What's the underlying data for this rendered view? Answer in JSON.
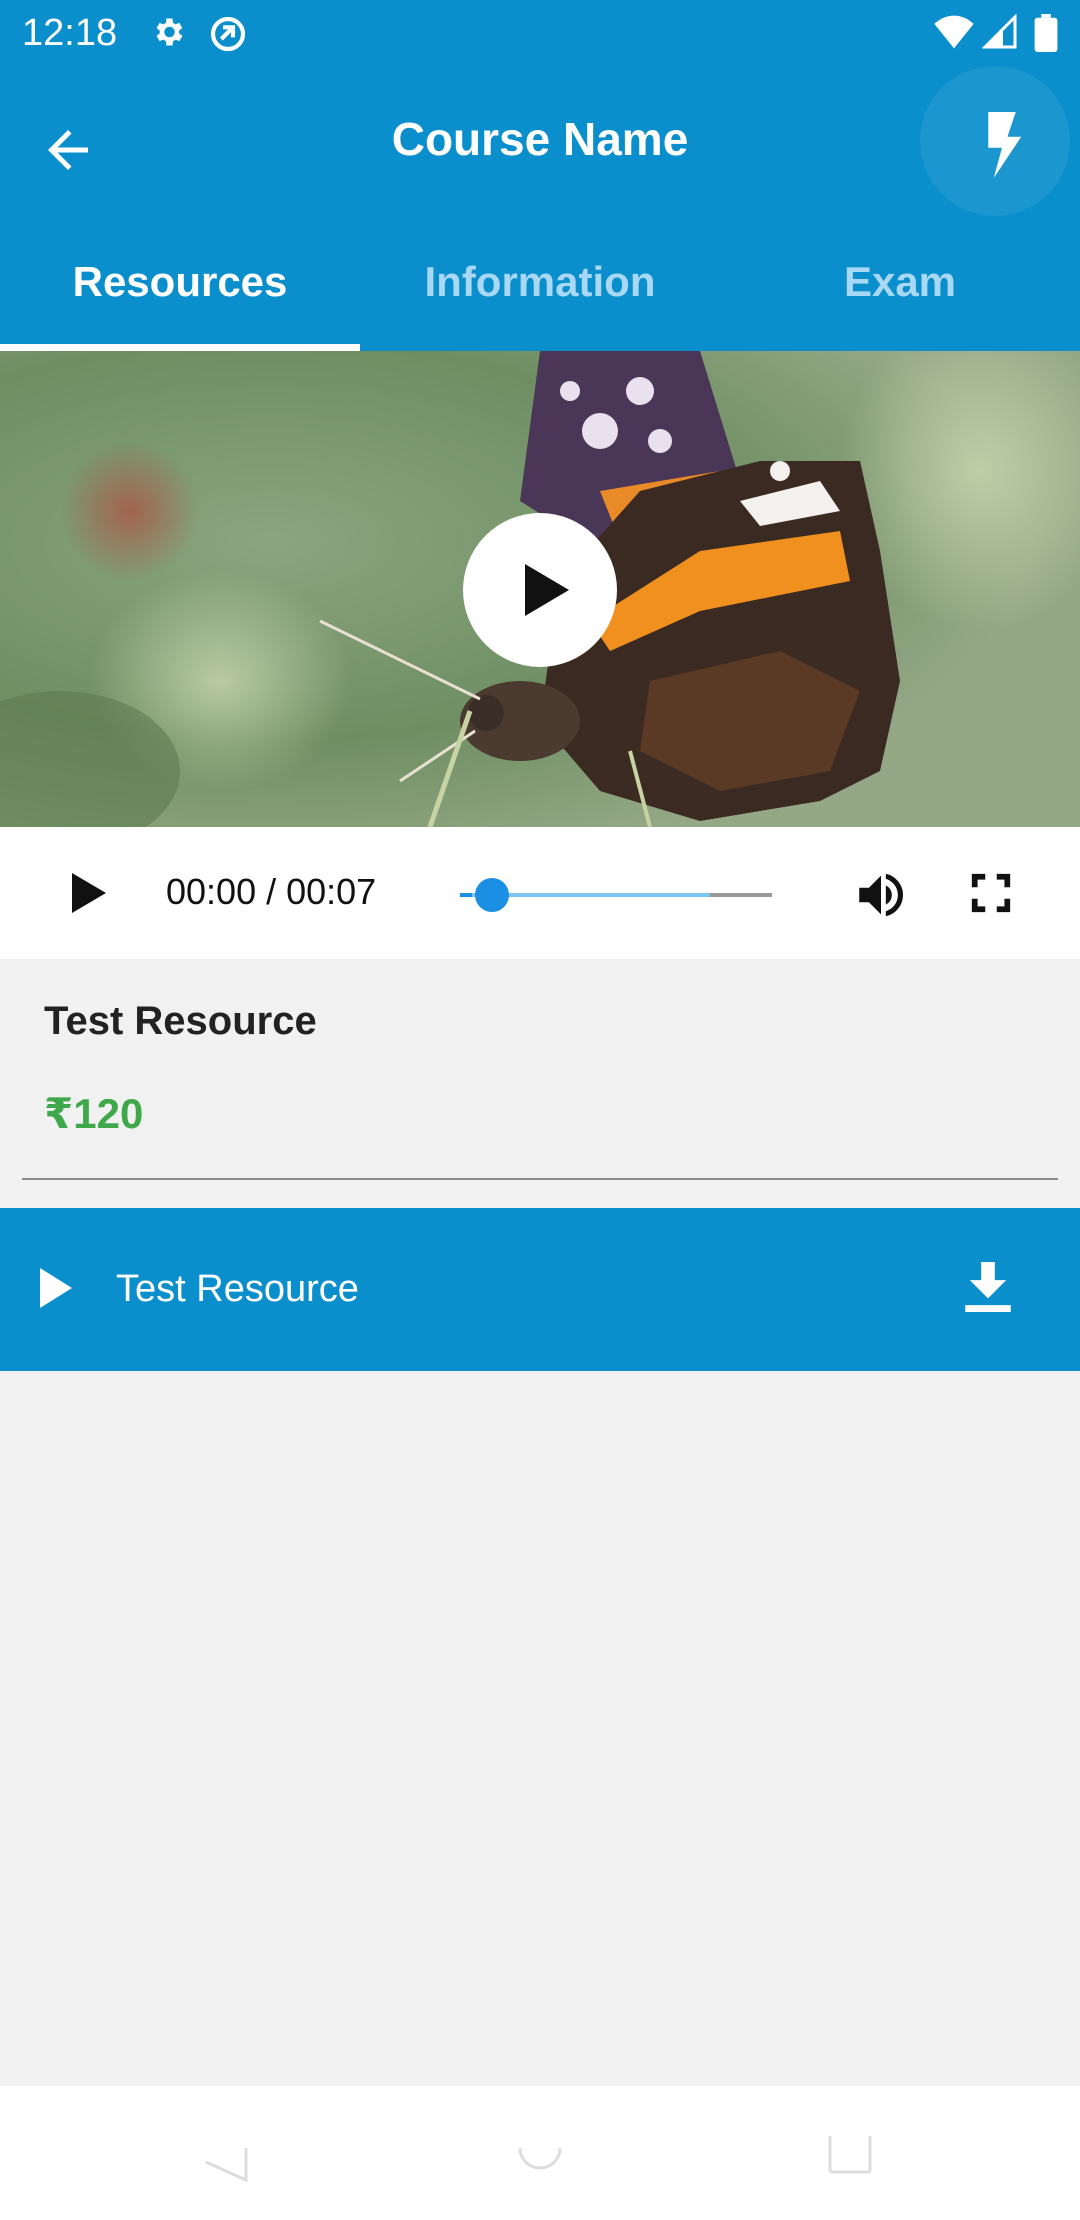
{
  "status_bar": {
    "time": "12:18",
    "icons": [
      "gear-icon",
      "sync-icon",
      "wifi-icon",
      "signal-icon",
      "battery-icon"
    ]
  },
  "app_bar": {
    "title": "Course Name",
    "back_icon": "arrow-left-icon",
    "action_icon": "flash-icon"
  },
  "tabs": [
    {
      "label": "Resources",
      "active": true
    },
    {
      "label": "Information",
      "active": false
    },
    {
      "label": "Exam",
      "active": false
    }
  ],
  "video": {
    "current_time": "00:00",
    "separator": " / ",
    "duration": "00:07",
    "played_fraction": 0.04,
    "buffered_fraction": 0.8
  },
  "resource": {
    "title": "Test Resource",
    "price": "₹120"
  },
  "resource_list": [
    {
      "label": "Test Resource",
      "icon": "play-icon",
      "action_icon": "download-icon"
    }
  ],
  "colors": {
    "primary": "#0a8fcc",
    "price": "#3ea84a",
    "seek": "#1a8fe3"
  }
}
